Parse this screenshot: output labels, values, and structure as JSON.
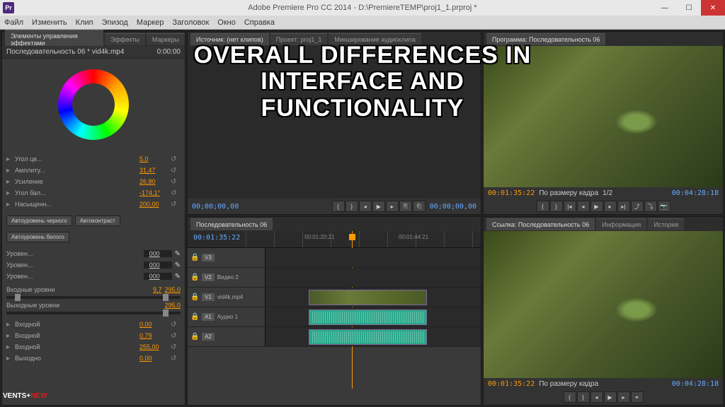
{
  "titlebar": {
    "app": "Pr",
    "title": "Adobe Premiere Pro CC 2014 - D:\\PremiereTEMP\\proj1_1.prproj *"
  },
  "menu": [
    "Файл",
    "Изменить",
    "Клип",
    "Эпизод",
    "Маркер",
    "Заголовок",
    "Окно",
    "Справка"
  ],
  "left": {
    "tabs": [
      "Элементы управления эффектами",
      "Эффекты",
      "Маркеры"
    ],
    "seq": "Последовательность 06 * vid4k.mp4",
    "seq_tc": "0:00:00",
    "params": [
      {
        "name": "Угол цв...",
        "val": "5,0"
      },
      {
        "name": "Амплиту...",
        "val": "31,47"
      },
      {
        "name": "Усиление",
        "val": "26,80"
      },
      {
        "name": "Угол бал...",
        "val": "-174,1°"
      },
      {
        "name": "Насыщенн...",
        "val": "200,00"
      }
    ],
    "btns": [
      "Автоуровень черного",
      "Автоконтраст",
      "Автоуровень белого"
    ],
    "levels": [
      {
        "name": "Уровен...",
        "val": "000"
      },
      {
        "name": "Уровен...",
        "val": "000"
      },
      {
        "name": "Уровен...",
        "val": "000"
      }
    ],
    "in_levels": {
      "label": "Входные уровни",
      "v1": "9,7",
      "v2": "295,0"
    },
    "out_levels": {
      "label": "Выходные уровни",
      "v1": "295,0"
    },
    "more": [
      {
        "name": "Входной",
        "val": "0,00"
      },
      {
        "name": "Входной",
        "val": "0,79"
      },
      {
        "name": "Входной",
        "val": "255,00"
      },
      {
        "name": "Выходно",
        "val": "0,00"
      }
    ]
  },
  "source": {
    "tabs": [
      "Источник: (нет клипов)",
      "Проект: proj1_1",
      "Микширование аудиоклипа"
    ],
    "tc_left": "00;00;00,00",
    "tc_right": "00;00;00,00"
  },
  "program": {
    "tab": "Программа: Последовательность 06",
    "tc_left": "00:01:35:22",
    "scale": "По размеру кадра",
    "half": "1/2",
    "tc_right": "00:04:28:18"
  },
  "timeline": {
    "tab": "Последовательность 06",
    "tc": "00:01:35:22",
    "marks": [
      "00:01:20:21",
      "00:01:44:21"
    ],
    "tracks": [
      {
        "id": "V3",
        "label": ""
      },
      {
        "id": "V2",
        "label": "Видео 2"
      },
      {
        "id": "V1",
        "label": "vid4k.mp4",
        "clip": "vid"
      },
      {
        "id": "A1",
        "label": "Аудио 1",
        "clip": "aud"
      },
      {
        "id": "A2",
        "label": "",
        "clip": "aud"
      }
    ]
  },
  "ref": {
    "tabs": [
      "Ссылка: Последовательность 06",
      "Информация",
      "История"
    ],
    "tc_left": "00:01:35:22",
    "scale": "По размеру кадра",
    "tc_right": "00:04:28:18"
  },
  "overlay": "OVERALL DIFFERENCES IN\nINTERFACE AND FUNCTIONALITY",
  "watermark": {
    "a": "VENTS+",
    "b": "NEW"
  }
}
